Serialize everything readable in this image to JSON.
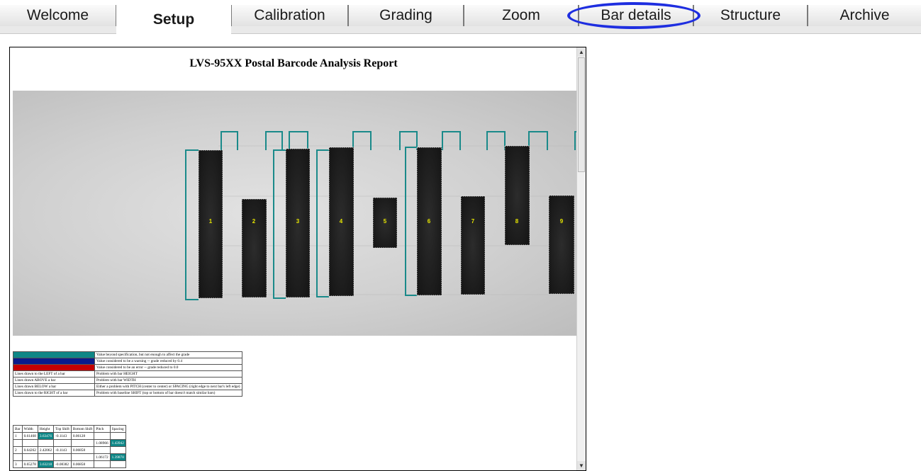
{
  "tabs": [
    {
      "label": "Welcome",
      "active": false
    },
    {
      "label": "Setup",
      "active": true
    },
    {
      "label": "Calibration",
      "active": false
    },
    {
      "label": "Grading",
      "active": false
    },
    {
      "label": "Zoom",
      "active": false
    },
    {
      "label": "Bar details",
      "active": false,
      "highlighted": true
    },
    {
      "label": "Structure",
      "active": false
    },
    {
      "label": "Archive",
      "active": false
    }
  ],
  "colors": {
    "highlight_circle": "#1e2ee0",
    "outline": "#1a8a8a",
    "cell_highlight": "#0e8686",
    "legend_warning": "#0a1a8a",
    "legend_error": "#c40000"
  },
  "report": {
    "title": "LVS-95XX Postal Barcode Analysis Report",
    "bar_labels": [
      "1",
      "2",
      "3",
      "4",
      "5",
      "6",
      "7",
      "8",
      "9"
    ],
    "legend": [
      {
        "swatch_color": "#0e8686",
        "key": "",
        "text": "Value beyond specification, but not enough to affect the grade"
      },
      {
        "swatch_color": "#0a1a8a",
        "key": "",
        "text": "Value considered to be a warning -- grade reduced by 0.4"
      },
      {
        "swatch_color": "#c40000",
        "key": "",
        "text": "Value considered to be an error -- grade reduced to 0.0"
      },
      {
        "swatch_color": "",
        "key": "Lines drawn to the LEFT of a bar",
        "text": "Problem with bar HEIGHT"
      },
      {
        "swatch_color": "",
        "key": "Lines drawn ABOVE a bar",
        "text": "Problem with bar WIDTH"
      },
      {
        "swatch_color": "",
        "key": "Lines drawn BELOW a bar",
        "text": "Either a problem with PITCH (center to center) or SPACING (right edge to next bar's left edge)"
      },
      {
        "swatch_color": "",
        "key": "Lines drawn to the RIGHT of a bar",
        "text": "Problem with baseline SHIFT (top or bottom of bar doesn't match similar bars)"
      }
    ],
    "table": {
      "headers": [
        "Bar",
        "Width",
        "Height",
        "Top Shift",
        "Bottom Shift",
        "Pitch",
        "Spacing"
      ],
      "rows": [
        {
          "cells": [
            "1",
            "0.61468",
            "3.63476",
            "-0.1143",
            "0.06128",
            "",
            ""
          ],
          "highlight": [
            2
          ]
        },
        {
          "cells": [
            "",
            "",
            "",
            "",
            "",
            "1.08966",
            "1.43942"
          ],
          "highlight": [
            6
          ]
        },
        {
          "cells": [
            "2",
            "0.64262",
            "2.42062",
            "-0.1143",
            "0.06858",
            "",
            ""
          ],
          "highlight": []
        },
        {
          "cells": [
            "",
            "",
            "",
            "",
            "",
            "1.06172",
            "1.39878"
          ],
          "highlight": [
            6
          ]
        },
        {
          "cells": [
            "3",
            "0.65278",
            "3.63218",
            "-0.08382",
            "0.06858",
            "",
            ""
          ],
          "highlight": [
            2
          ]
        }
      ]
    }
  }
}
